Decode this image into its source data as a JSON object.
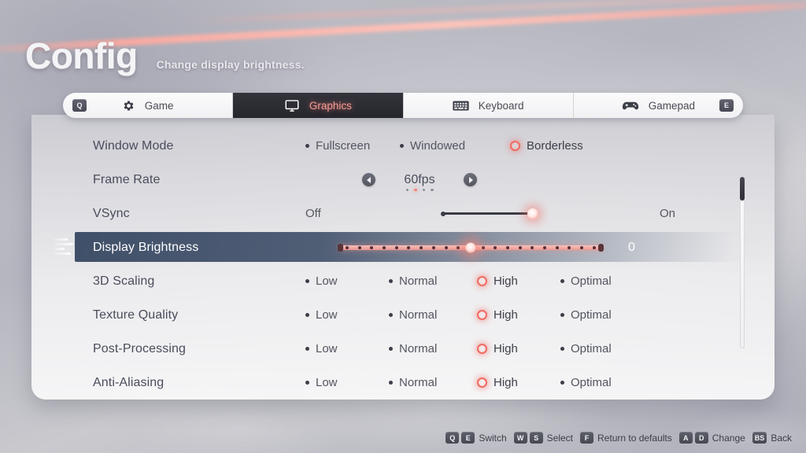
{
  "header": {
    "title": "Config",
    "subtitle": "Change display brightness."
  },
  "tabs": [
    {
      "label": "Game",
      "icon": "gear-icon",
      "key": "Q",
      "key_side": "left",
      "active": false
    },
    {
      "label": "Graphics",
      "icon": "monitor-icon",
      "key": "",
      "key_side": "",
      "active": true
    },
    {
      "label": "Keyboard",
      "icon": "keyboard-icon",
      "key": "",
      "key_side": "",
      "active": false
    },
    {
      "label": "Gamepad",
      "icon": "gamepad-icon",
      "key": "E",
      "key_side": "right",
      "active": false
    }
  ],
  "settings": {
    "window_mode": {
      "label": "Window Mode",
      "options": [
        "Fullscreen",
        "Windowed",
        "Borderless"
      ],
      "selected": "Borderless"
    },
    "frame_rate": {
      "label": "Frame Rate",
      "value": "60fps",
      "page_count": 4,
      "page_index": 1
    },
    "vsync": {
      "label": "VSync",
      "off_label": "Off",
      "on_label": "On",
      "state": "On"
    },
    "display_brightness": {
      "label": "Display Brightness",
      "value": "0",
      "notch_count": 21,
      "selected": true
    },
    "scaling_3d": {
      "label": "3D Scaling",
      "options": [
        "Low",
        "Normal",
        "High",
        "Optimal"
      ],
      "selected": "High"
    },
    "texture_quality": {
      "label": "Texture Quality",
      "options": [
        "Low",
        "Normal",
        "High",
        "Optimal"
      ],
      "selected": "High"
    },
    "post_processing": {
      "label": "Post-Processing",
      "options": [
        "Low",
        "Normal",
        "High",
        "Optimal"
      ],
      "selected": "High"
    },
    "anti_aliasing": {
      "label": "Anti-Aliasing",
      "options": [
        "Low",
        "Normal",
        "High",
        "Optimal"
      ],
      "selected": "High"
    }
  },
  "footer_hints": [
    {
      "keys": [
        "Q",
        "E"
      ],
      "action": "Switch"
    },
    {
      "keys": [
        "W",
        "S"
      ],
      "action": "Select"
    },
    {
      "keys": [
        "F"
      ],
      "action": "Return to defaults"
    },
    {
      "keys": [
        "A",
        "D"
      ],
      "action": "Change"
    },
    {
      "keys": [
        "BS"
      ],
      "action": "Back"
    }
  ],
  "colors": {
    "accent": "#f06a62",
    "selected_row": "#3a4a64",
    "active_tab_bg": "#2b2b33",
    "label": "#4a4c5b"
  }
}
